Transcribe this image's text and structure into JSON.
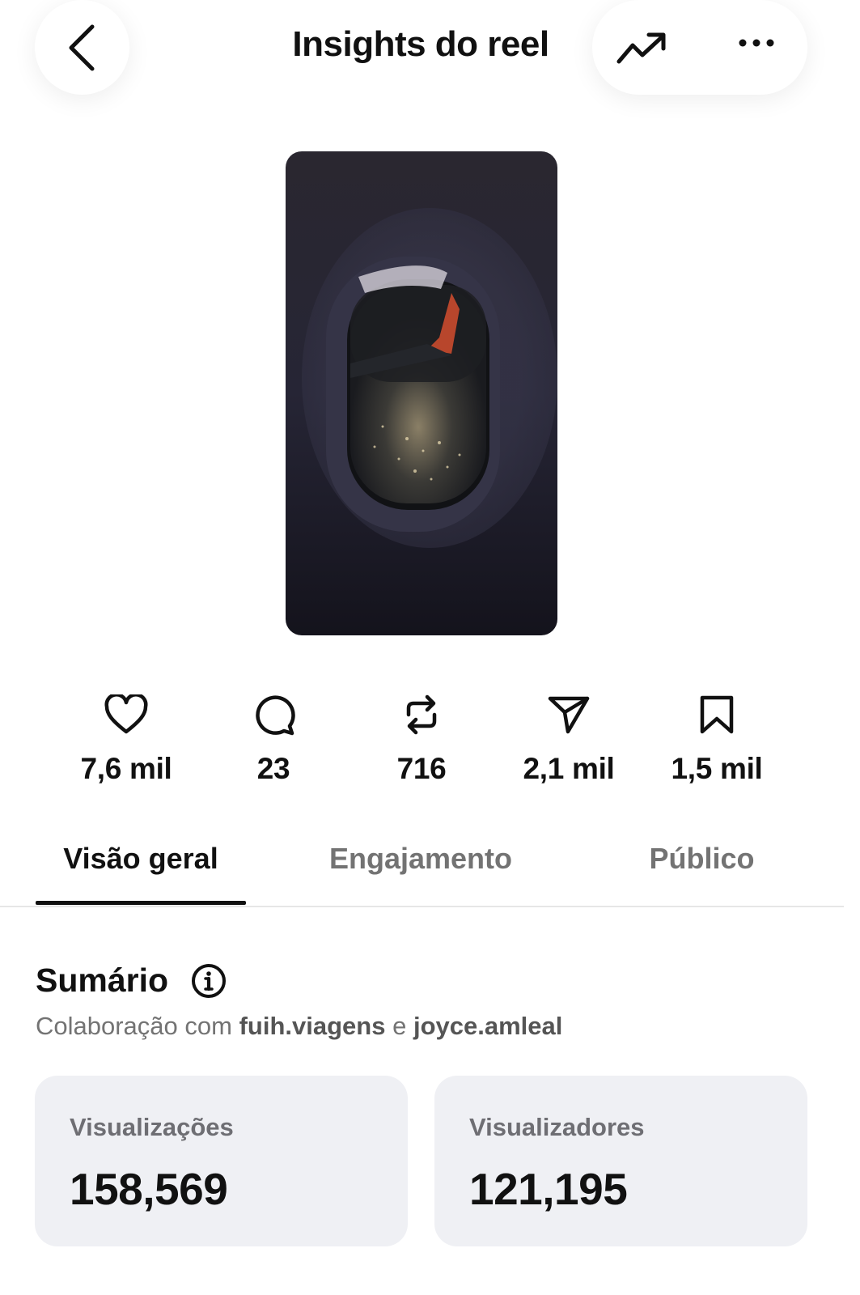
{
  "header": {
    "title": "Insights do reel",
    "back_icon": "chevron-left-icon",
    "trend_icon": "trending-up-icon",
    "more_icon": "more-horizontal-icon"
  },
  "stats": [
    {
      "icon": "heart-icon",
      "value": "7,6 mil"
    },
    {
      "icon": "comment-icon",
      "value": "23"
    },
    {
      "icon": "repost-icon",
      "value": "716"
    },
    {
      "icon": "share-icon",
      "value": "2,1 mil"
    },
    {
      "icon": "bookmark-icon",
      "value": "1,5 mil"
    }
  ],
  "tabs": [
    {
      "label": "Visão geral",
      "active": true
    },
    {
      "label": "Engajamento",
      "active": false
    },
    {
      "label": "Público",
      "active": false
    }
  ],
  "summary": {
    "title": "Sumário",
    "collab_prefix": "Colaboração com",
    "collab_user1": "fuih.viagens",
    "collab_and": "e",
    "collab_user2": "joyce.amleal"
  },
  "cards": [
    {
      "label": "Visualizações",
      "value": "158,569"
    },
    {
      "label": "Visualizadores",
      "value": "121,195"
    }
  ],
  "colors": {
    "text_primary": "#111111",
    "text_secondary": "#737373",
    "card_bg": "#eff0f4"
  }
}
